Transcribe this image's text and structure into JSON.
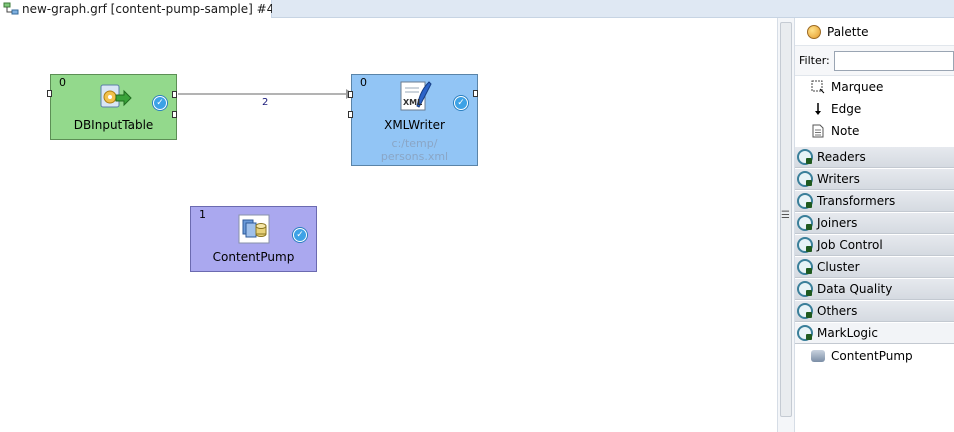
{
  "tab": {
    "label": "new-graph.grf [content-pump-sample] #4",
    "close": "☒"
  },
  "graph": {
    "components": [
      {
        "id": "dbinput",
        "phase": "0",
        "name": "DBInputTable",
        "sub": ""
      },
      {
        "id": "xmlwriter",
        "phase": "0",
        "name": "XMLWriter",
        "sub1": "c:/temp/",
        "sub2": "persons.xml",
        "icon_text": "XML"
      },
      {
        "id": "cpump",
        "phase": "1",
        "name": "ContentPump",
        "sub": ""
      }
    ],
    "edge_label": "2",
    "colors": {
      "dbinput": "#93d98c",
      "xmlwriter": "#92c5f5",
      "cpump": "#aaa8ef"
    }
  },
  "palette": {
    "title": "Palette",
    "filter_label": "Filter:",
    "filter_value": "",
    "tools": [
      {
        "label": "Marquee",
        "icon": "marquee-icon"
      },
      {
        "label": "Edge",
        "icon": "edge-arrow-icon"
      },
      {
        "label": "Note",
        "icon": "note-icon"
      }
    ],
    "drawers": [
      {
        "label": "Readers"
      },
      {
        "label": "Writers"
      },
      {
        "label": "Transformers"
      },
      {
        "label": "Joiners"
      },
      {
        "label": "Job Control"
      },
      {
        "label": "Cluster"
      },
      {
        "label": "Data Quality"
      },
      {
        "label": "Others"
      },
      {
        "label": "MarkLogic"
      }
    ],
    "marklogic_items": [
      {
        "label": "ContentPump",
        "icon": "contentpump-icon"
      }
    ]
  }
}
